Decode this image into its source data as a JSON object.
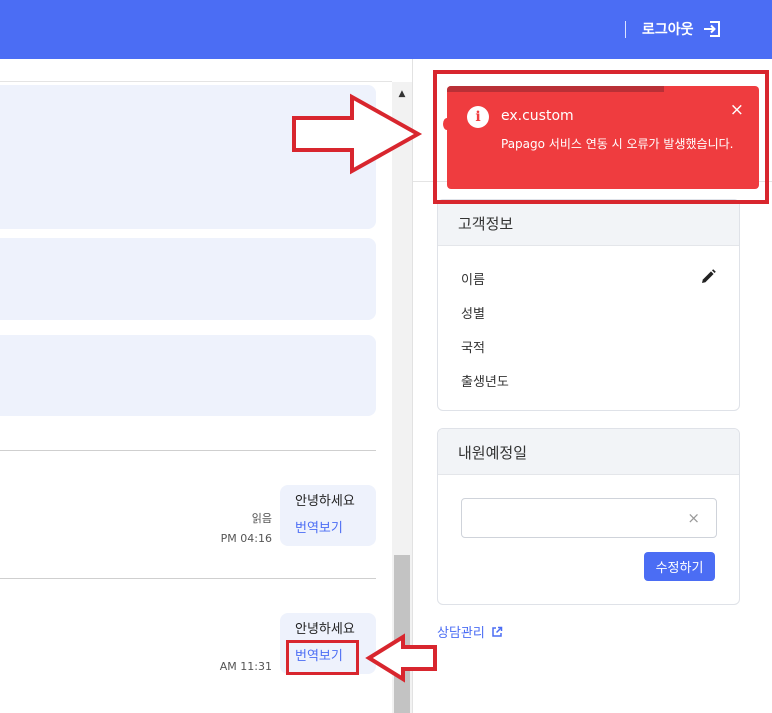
{
  "header": {
    "logout_label": "로그아웃",
    "accent": "#4b6df4"
  },
  "chat": {
    "messages": [
      {
        "text": "안녕하세요",
        "translate_label": "번역보기",
        "status": "읽음",
        "time": "PM 04:16"
      },
      {
        "text": "안녕하세요",
        "translate_label": "번역보기",
        "time": "AM 11:31"
      }
    ]
  },
  "customer_info": {
    "title": "고객정보",
    "fields": [
      "이름",
      "성별",
      "국적",
      "출생년도"
    ]
  },
  "visit_date": {
    "title": "내원예정일",
    "input_value": "",
    "clear_glyph": "×",
    "save_label": "수정하기"
  },
  "consult_link_label": "상담관리",
  "toast": {
    "title": "ex.custom",
    "message": "Papago 서비스 연동 시 오류가 발생했습니다.",
    "close_glyph": "×",
    "color": "#ef3c3f"
  },
  "icons": [
    "logout-icon",
    "info-icon",
    "close-icon",
    "edit-icon",
    "external-link-icon",
    "scroll-up-icon"
  ]
}
